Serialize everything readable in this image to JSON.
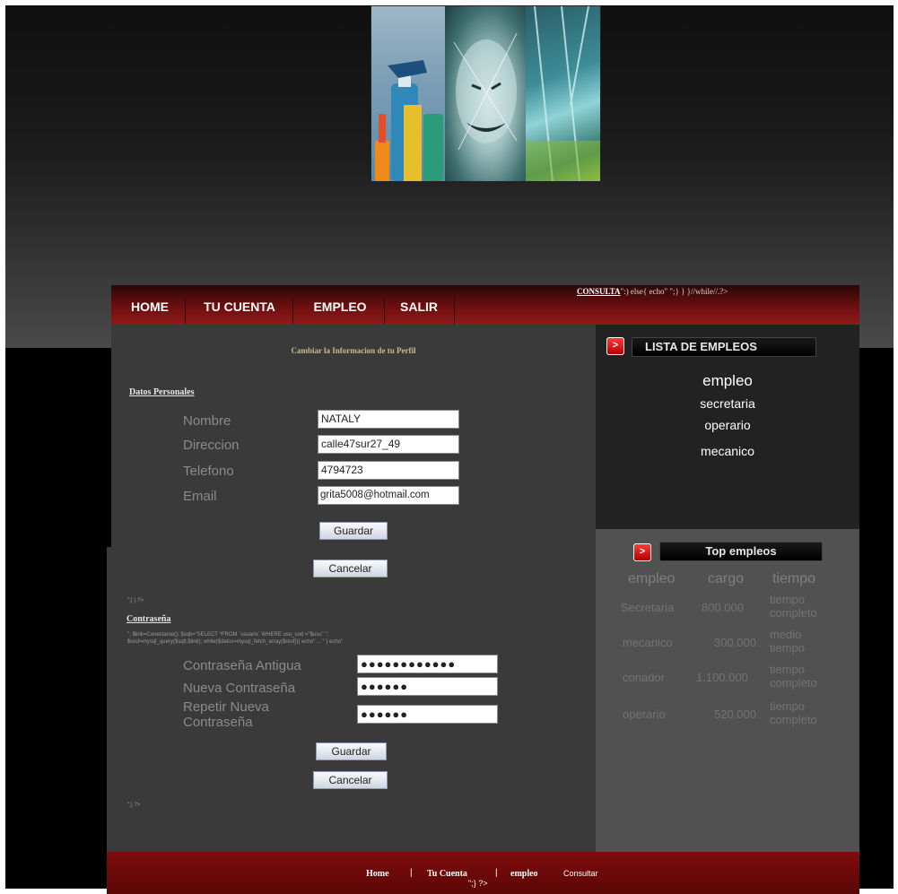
{
  "nav": {
    "items": [
      "HOME",
      "TU CUENTA",
      "EMPLEO",
      "SALIR"
    ],
    "consulta_label": "CONSULTA",
    "consulta_code": "\":) else{ echo\" \";} } }//while//.?>"
  },
  "profile": {
    "title": "Cambiar la Informacion de tu Perfil",
    "section_label": "Datos Personales",
    "fields": [
      {
        "label": "Nombre",
        "value": "NATALY"
      },
      {
        "label": "Direccion",
        "value": "calle47sur27_49"
      },
      {
        "label": "Telefono",
        "value": "4794723"
      },
      {
        "label": "Email",
        "value": "grita5008@hotmail.com"
      }
    ],
    "save_label": "Guardar",
    "cancel_label": "Cancelar",
    "code_after": "\";} } ?>"
  },
  "password": {
    "section_label": "Contraseña",
    "code_line1": "\"; $link=Conectarse(); $sqlt=\"SELECT *FROM `usuario` WHERE usu_cod =\"$usu\" \";",
    "code_line2": "$resf=mysql_query($sqlt,$link); while($datos=mysql_fetch_array($resf)){ echo\" ... \" } echo\"",
    "fields": [
      {
        "label": "Contraseña Antigua",
        "value": "●●●●●●●●●●●●"
      },
      {
        "label": "Nueva Contraseña",
        "value": "●●●●●●"
      },
      {
        "label": "Repetir Nueva Contraseña",
        "value": "●●●●●●"
      }
    ],
    "save_label": "Guardar",
    "cancel_label": "Cancelar",
    "code_after": "\";} ?>"
  },
  "employments": {
    "title": "LISTA DE EMPLEOS",
    "items": [
      "empleo",
      "secretaria",
      "operario",
      "mecanico"
    ]
  },
  "top": {
    "title": "Top empleos",
    "headers": [
      "empleo",
      "cargo",
      "tiempo"
    ],
    "rows": [
      {
        "empleo": "Secretaria",
        "cargo": "800.000",
        "tiempo": "tiempo completo"
      },
      {
        "empleo": "mecanico",
        "cargo": "300.000",
        "tiempo": "medio tiempo"
      },
      {
        "empleo": "conador",
        "cargo": "1.100.000",
        "tiempo": "tiempo completo"
      },
      {
        "empleo": "operario",
        "cargo": "520.000",
        "tiempo": "tiempo completo"
      }
    ]
  },
  "footer": {
    "links": [
      "Home",
      "Tu Cuenta",
      "empleo"
    ],
    "separator": "|",
    "consultar": "Consultar",
    "code": "\";} ?>"
  },
  "colors": {
    "nav_red": "#8f1a1a",
    "footer_red": "#7e0c0c",
    "panel": "#3a3a3a"
  }
}
